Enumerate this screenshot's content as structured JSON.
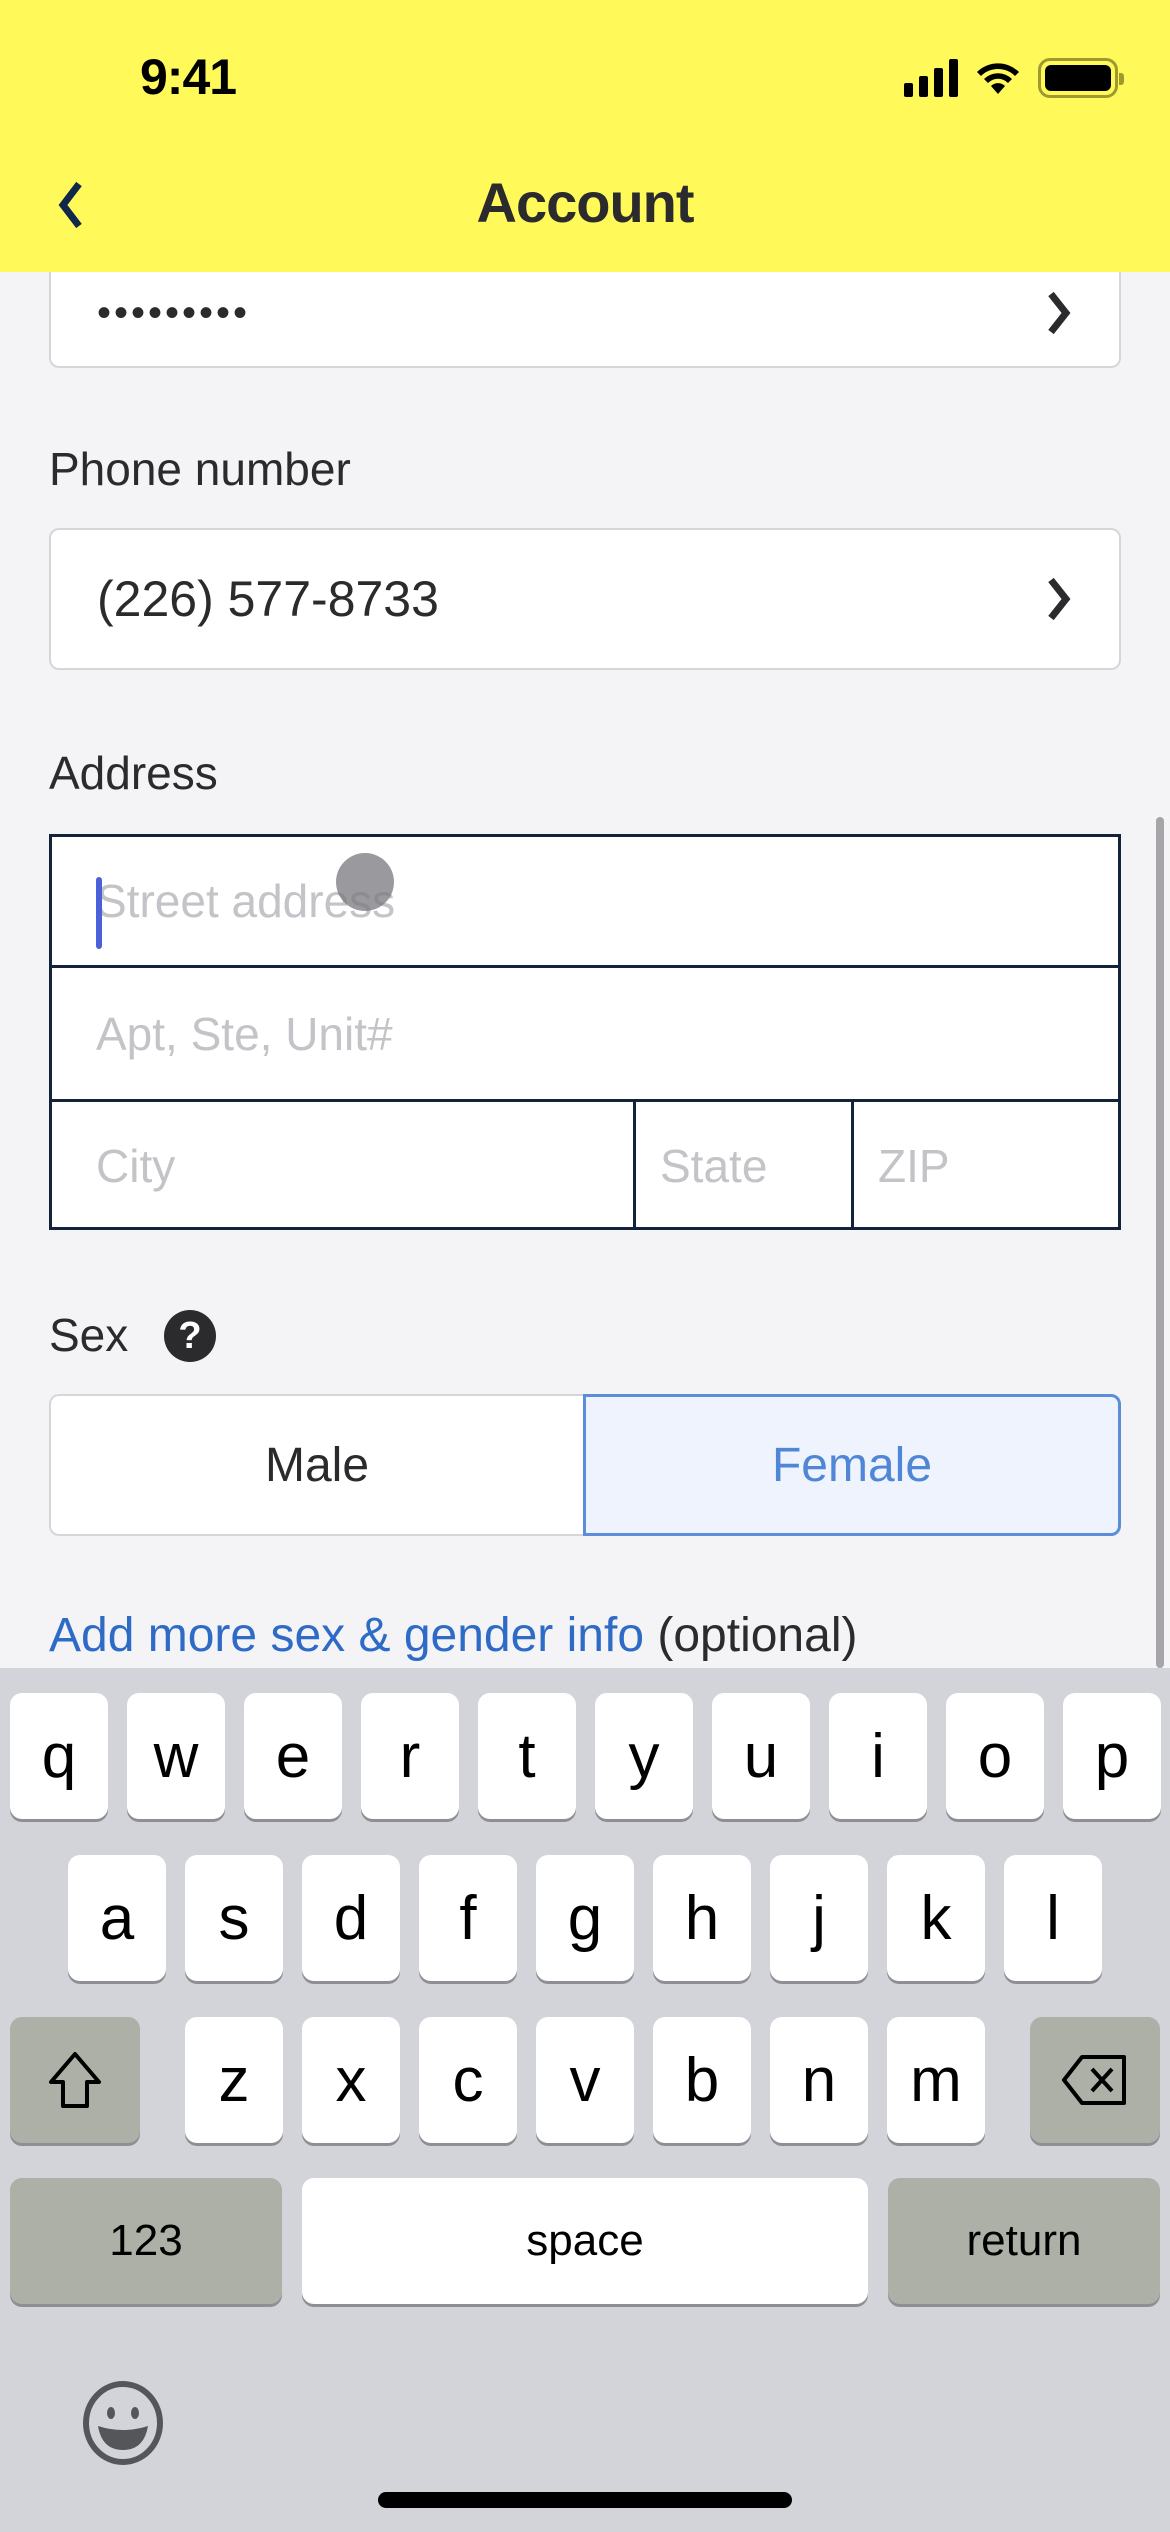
{
  "status_bar": {
    "time": "9:41"
  },
  "header": {
    "title": "Account",
    "back_icon": "chevron-left-icon"
  },
  "password": {
    "value": "•••••••••"
  },
  "phone": {
    "label": "Phone number",
    "value": "(226) 577-8733"
  },
  "address": {
    "label": "Address",
    "street_placeholder": "Street address",
    "apt_placeholder": "Apt, Ste, Unit#",
    "city_placeholder": "City",
    "state_placeholder": "State",
    "zip_placeholder": "ZIP",
    "street_value": "",
    "apt_value": "",
    "city_value": "",
    "state_value": "",
    "zip_value": ""
  },
  "sex": {
    "label": "Sex",
    "help_icon": "?",
    "options": [
      "Male",
      "Female"
    ],
    "selected": "Female"
  },
  "more_info": {
    "link": "Add more sex & gender info",
    "suffix": " (optional)"
  },
  "colors": {
    "header_bg": "#fffa5a",
    "link": "#2e6bc6",
    "selected_border": "#5b8ed9",
    "address_border": "#13233a",
    "cursor": "#4a62d9"
  },
  "keyboard": {
    "row1": [
      "q",
      "w",
      "e",
      "r",
      "t",
      "y",
      "u",
      "i",
      "o",
      "p"
    ],
    "row2": [
      "a",
      "s",
      "d",
      "f",
      "g",
      "h",
      "j",
      "k",
      "l"
    ],
    "row3": [
      "z",
      "x",
      "c",
      "v",
      "b",
      "n",
      "m"
    ],
    "numbers": "123",
    "space": "space",
    "return": "return"
  }
}
